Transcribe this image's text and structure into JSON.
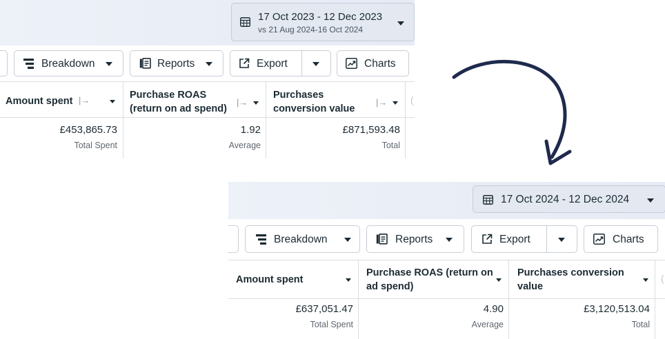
{
  "before": {
    "date_range": "17 Oct 2023 - 12 Dec 2023",
    "compare_range": "vs 21 Aug 2024-16 Oct 2024",
    "toolbar": {
      "breakdown": "Breakdown",
      "reports": "Reports",
      "export": "Export",
      "charts": "Charts"
    },
    "columns": [
      {
        "header": "Amount spent",
        "value": "£453,865.73",
        "summary": "Total Spent"
      },
      {
        "header": "Purchase ROAS (return on ad spend)",
        "value": "1.92",
        "summary": "Average"
      },
      {
        "header": "Purchases conversion value",
        "value": "£871,593.48",
        "summary": "Total"
      }
    ]
  },
  "after": {
    "date_range": "17 Oct 2024 - 12 Dec 2024",
    "toolbar": {
      "breakdown": "Breakdown",
      "reports": "Reports",
      "export": "Export",
      "charts": "Charts"
    },
    "columns": [
      {
        "header": "Amount spent",
        "value": "£637,051.47",
        "summary": "Total Spent"
      },
      {
        "header": "Purchase ROAS (return on ad spend)",
        "value": "4.90",
        "summary": "Average"
      },
      {
        "header": "Purchases conversion value",
        "value": "£3,120,513.04",
        "summary": "Total"
      }
    ]
  },
  "colors": {
    "text": "#1c2b33",
    "border": "#c8ced6",
    "header_bg": "#e6ebf5",
    "arrow": "#1f2a4d"
  },
  "icons": [
    "calendar-icon",
    "breakdown-icon",
    "reports-icon",
    "export-icon",
    "charts-icon",
    "dropdown-caret-icon",
    "pin-column-icon",
    "curved-arrow-icon"
  ]
}
